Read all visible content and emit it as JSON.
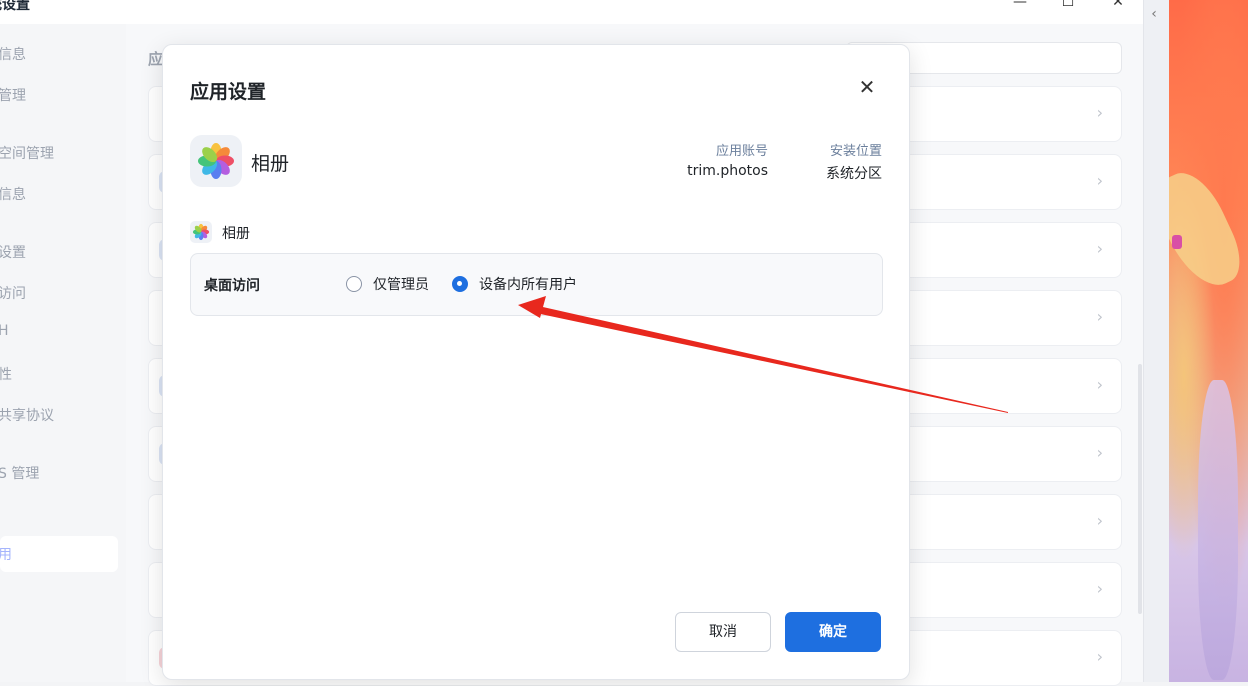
{
  "window": {
    "title": "统设置",
    "minimize_glyph": "—",
    "maximize_glyph": "☐",
    "close_glyph": "✕",
    "collapse_glyph": "‹"
  },
  "sidebar": {
    "items": [
      {
        "label": "信息"
      },
      {
        "label": "管理"
      },
      {
        "label": "空间管理"
      },
      {
        "label": "信息"
      },
      {
        "label": "设置"
      },
      {
        "label": "访问"
      },
      {
        "label": "H"
      },
      {
        "label": "性"
      },
      {
        "label": "共享协议"
      },
      {
        "label": "S 管理"
      }
    ],
    "active_label": "用"
  },
  "content": {
    "heading": "应",
    "row_chevron": "›"
  },
  "dialog": {
    "title": "应用设置",
    "close_glyph": "✕",
    "app": {
      "name": "相册",
      "icon": "photos-flower-icon",
      "account_label": "应用账号",
      "account_value": "trim.photos",
      "location_label": "安装位置",
      "location_value": "系统分区"
    },
    "section_app_name": "相册",
    "permission": {
      "label": "桌面访问",
      "options": [
        {
          "label": "仅管理员",
          "checked": false
        },
        {
          "label": "设备内所有用户",
          "checked": true
        }
      ]
    },
    "buttons": {
      "cancel": "取消",
      "ok": "确定"
    }
  },
  "colors": {
    "accent": "#1e6fe0",
    "annotation_arrow": "#e8281e"
  }
}
